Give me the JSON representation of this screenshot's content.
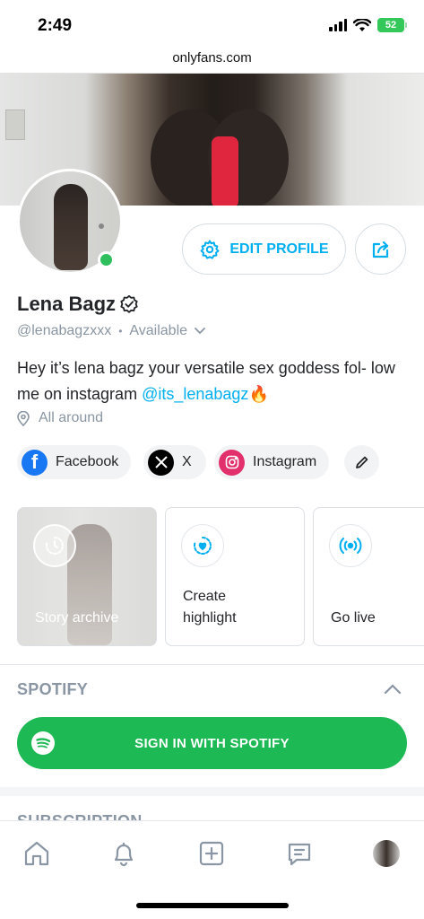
{
  "status_bar": {
    "time": "2:49",
    "battery": "52"
  },
  "browser": {
    "url": "onlyfans.com"
  },
  "profile": {
    "edit_label": "EDIT PROFILE",
    "name": "Lena Bagz",
    "handle": "@lenabagzxxx",
    "availability": "Available",
    "bio_text": "Hey it’s lena bagz your versatile sex goddess fol- low me on instagram",
    "bio_link": "@its_lenabagz",
    "bio_emoji": "🔥",
    "location": "All around"
  },
  "social_links": [
    {
      "label": "Facebook",
      "icon": "facebook-icon",
      "color": "#1877f2"
    },
    {
      "label": "X",
      "icon": "x-icon",
      "color": "#000000"
    },
    {
      "label": "Instagram",
      "icon": "instagram-icon",
      "color": "#e1306c"
    }
  ],
  "cards": {
    "story_archive": "Story archive",
    "create_highlight": "Create highlight",
    "go_live": "Go live"
  },
  "spotify": {
    "section_title": "SPOTIFY",
    "button_label": "SIGN IN WITH SPOTIFY"
  },
  "subscription": {
    "section_title": "SUBSCRIPTION"
  },
  "colors": {
    "accent": "#00aff0",
    "spotify": "#1db954",
    "online": "#2fbf5c"
  }
}
